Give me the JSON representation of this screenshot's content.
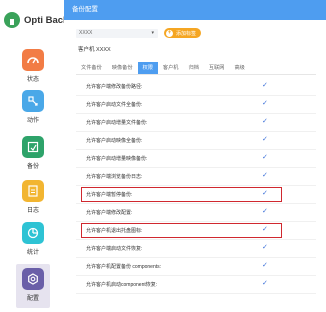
{
  "app": {
    "name": "Opti Backup",
    "brand_color": "#3aa25a"
  },
  "sidebar": {
    "items": [
      {
        "label": "状态",
        "icon": "status-gauge-icon",
        "color": "#f27c45"
      },
      {
        "label": "动作",
        "icon": "action-icon",
        "color": "#4aa8e8"
      },
      {
        "label": "备份",
        "icon": "backup-icon",
        "color": "#2ea36a"
      },
      {
        "label": "日志",
        "icon": "log-icon",
        "color": "#f2b531"
      },
      {
        "label": "统计",
        "icon": "stats-pie-icon",
        "color": "#2ec3d4"
      },
      {
        "label": "配置",
        "icon": "settings-hex-icon",
        "color": "#6a5fa8"
      }
    ],
    "active": "配置"
  },
  "header": {
    "title": "备份配置",
    "bg_color": "#4e9df0"
  },
  "controls": {
    "select_value": "XXXX",
    "add_button_label": "添加标签",
    "client_id": "客户机 XXXX"
  },
  "tabs": [
    "文件备份",
    "映像备份",
    "权限",
    "客户机",
    "归档",
    "互联网",
    "高级"
  ],
  "active_tab": "权限",
  "permissions": [
    {
      "label": "允许客户端修改备份路径:",
      "checked": "✓"
    },
    {
      "label": "允许客户启动文件全备份:",
      "checked": "✓"
    },
    {
      "label": "允许客户启动增量文件备份:",
      "checked": "✓"
    },
    {
      "label": "允许客户启动映像全备份:",
      "checked": "✓"
    },
    {
      "label": "允许客户启动增量映像备份:",
      "checked": "✓"
    },
    {
      "label": "允许客户端浏览备份日志:",
      "checked": "✓"
    },
    {
      "label": "允许客户端暂停备份:",
      "checked": "✓",
      "highlighted": true
    },
    {
      "label": "允许客户端修改配置:",
      "checked": "✓"
    },
    {
      "label": "允许客户机退出托盘图标:",
      "checked": "✓",
      "highlighted": true
    },
    {
      "label": "允许客户端启动文件恢复:",
      "checked": "✓"
    },
    {
      "label": "允许客户机配置备份 components:",
      "checked": "✓"
    },
    {
      "label": "允许客户机启动component恢复:",
      "checked": "✓"
    }
  ]
}
